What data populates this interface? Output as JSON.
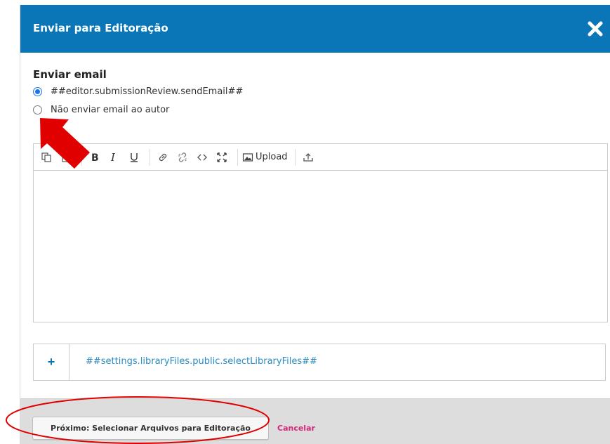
{
  "modal": {
    "title": "Enviar para Editoração",
    "close_icon": "close-icon"
  },
  "email": {
    "section_label": "Enviar email",
    "options": [
      {
        "label": "##editor.submissionReview.sendEmail##",
        "checked": true
      },
      {
        "label": "Não enviar email ao autor",
        "checked": false
      }
    ]
  },
  "toolbar": {
    "items": [
      "copy-icon",
      "paste-icon",
      "bold-icon",
      "italic-icon",
      "underline-icon",
      "link-icon",
      "unlink-icon",
      "code-icon",
      "fullscreen-icon",
      "image-icon",
      "upload-icon"
    ],
    "upload_label": "Upload"
  },
  "files": {
    "add_label": "+",
    "select_label": "##settings.libraryFiles.public.selectLibraryFiles##"
  },
  "footer": {
    "next_label": "Próximo: Selecionar Arquivos para Editoração",
    "cancel_label": "Cancelar"
  },
  "colors": {
    "header": "#0a76b7",
    "link": "#2b8abf",
    "cancel": "#d6257a",
    "annotation": "#e00000"
  }
}
